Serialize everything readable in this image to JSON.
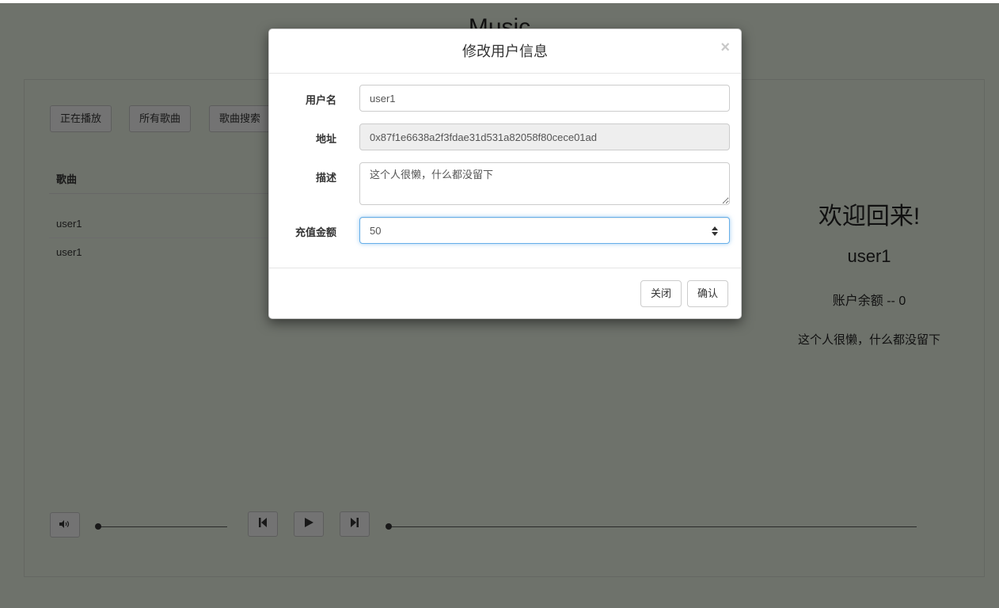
{
  "app": {
    "title": "Music"
  },
  "tabs": [
    {
      "label": "正在播放"
    },
    {
      "label": "所有歌曲"
    },
    {
      "label": "歌曲搜索"
    }
  ],
  "song_table": {
    "header": "歌曲",
    "rows": [
      "user1",
      "user1"
    ]
  },
  "welcome": {
    "greeting": "欢迎回来!",
    "username": "user1",
    "balance_label": "账户余额 -- 0",
    "description": "这个人很懒，什么都没留下"
  },
  "player": {
    "volume_icon": "volume-icon",
    "prev_icon": "skip-previous-icon",
    "play_icon": "play-icon",
    "next_icon": "skip-next-icon",
    "volume_level": 0,
    "progress": 0
  },
  "modal": {
    "title": "修改用户信息",
    "close_glyph": "×",
    "fields": {
      "username_label": "用户名",
      "username_value": "user1",
      "address_label": "地址",
      "address_value": "0x87f1e6638a2f3fdae31d531a82058f80cece01ad",
      "description_label": "描述",
      "description_value": "这个人很懒，什么都没留下",
      "recharge_label": "充值金额",
      "recharge_value": "50"
    },
    "close_button": "关闭",
    "confirm_button": "确认"
  },
  "colors": {
    "page_background": "#dde4d7",
    "backdrop": "rgba(0,0,0,0.5)",
    "focus_border": "#66afe9"
  }
}
